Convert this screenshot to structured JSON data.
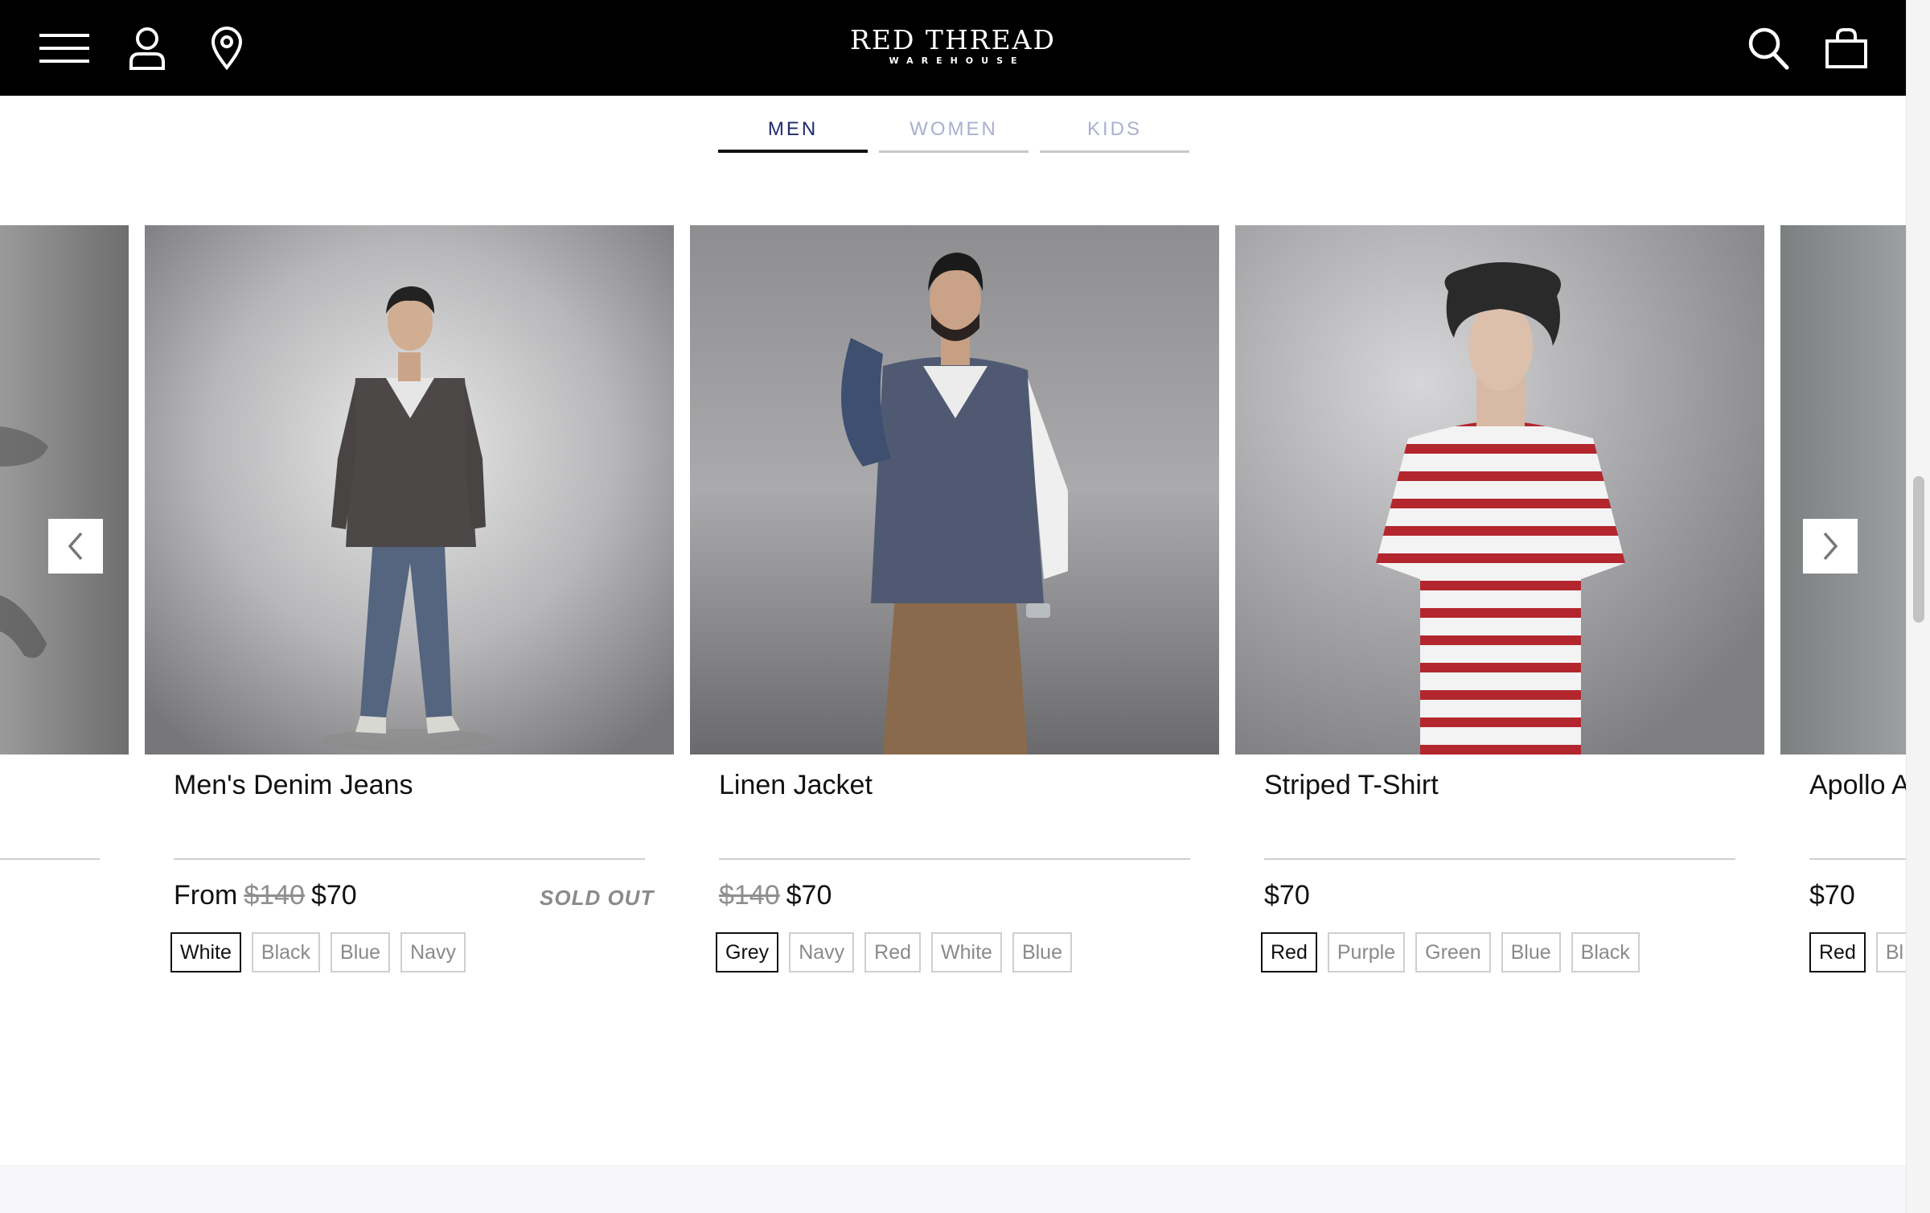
{
  "brand": {
    "name": "RED THREAD",
    "sub": "WAREHOUSE"
  },
  "header_icons": [
    "menu-icon",
    "account-icon",
    "location-icon",
    "search-icon",
    "bag-icon"
  ],
  "tabs": [
    {
      "label": "MEN",
      "active": true
    },
    {
      "label": "WOMEN",
      "active": false
    },
    {
      "label": "KIDS",
      "active": false
    }
  ],
  "products": [
    {
      "title": "Men's Denim Jeans",
      "price_prefix": "From",
      "old_price": "$140",
      "price": "$70",
      "status": "SOLD OUT",
      "colors": [
        "White",
        "Black",
        "Blue",
        "Navy"
      ],
      "selected_color": "White"
    },
    {
      "title": "Linen Jacket",
      "old_price": "$140",
      "price": "$70",
      "colors": [
        "Grey",
        "Navy",
        "Red",
        "White",
        "Blue"
      ],
      "selected_color": "Grey"
    },
    {
      "title": "Striped T-Shirt",
      "price": "$70",
      "colors": [
        "Red",
        "Purple",
        "Green",
        "Blue",
        "Black"
      ],
      "selected_color": "Red"
    },
    {
      "title": "Apollo A",
      "price": "$70",
      "colors": [
        "Red",
        "Bl"
      ],
      "selected_color": "Red"
    }
  ],
  "carousel": {
    "prev_icon": "chevron-left-icon",
    "next_icon": "chevron-right-icon"
  },
  "colors": {
    "header_bg": "#000000",
    "active_tab": "#1d2a6e",
    "inactive_tab": "#a9b0cf",
    "sold_out": "#8a8a8a"
  }
}
